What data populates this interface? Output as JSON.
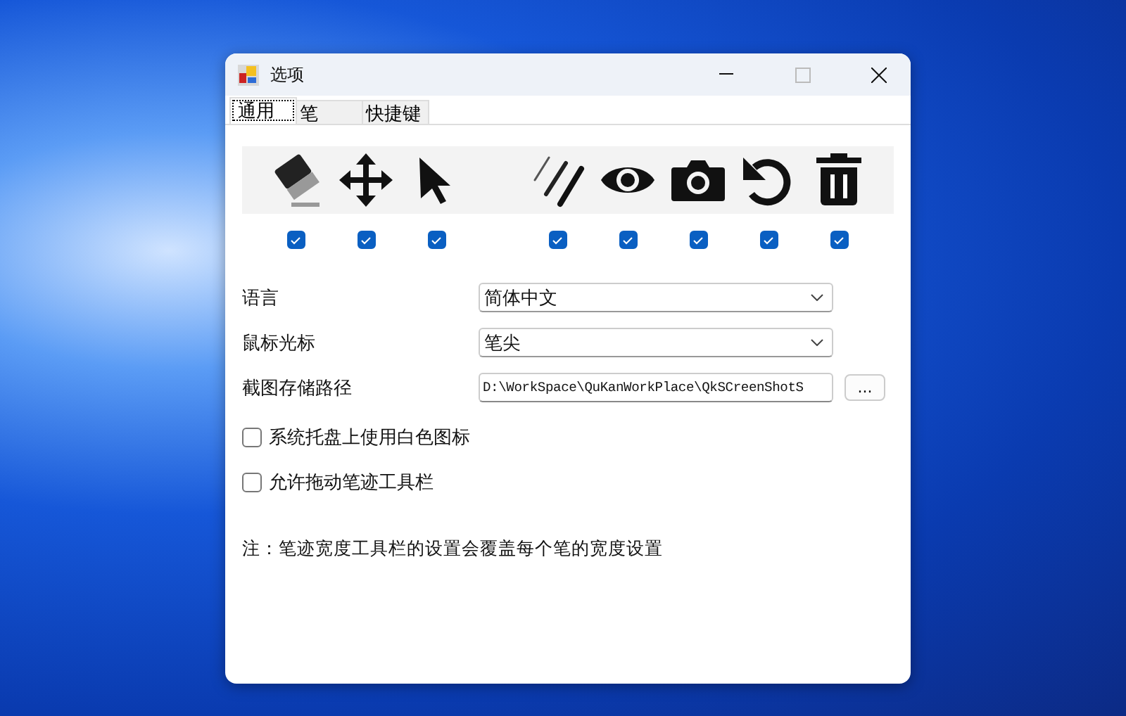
{
  "window": {
    "title": "选项"
  },
  "tabs": [
    {
      "label": "通用",
      "selected": true
    },
    {
      "label": "笔",
      "selected": false
    },
    {
      "label": "快捷键",
      "selected": false
    }
  ],
  "toolbar": {
    "groups": [
      [
        {
          "kind": "eraser",
          "checked": true
        },
        {
          "kind": "move",
          "checked": true
        },
        {
          "kind": "pointer",
          "checked": true
        }
      ],
      [
        {
          "kind": "lines",
          "checked": true
        },
        {
          "kind": "eye",
          "checked": true
        },
        {
          "kind": "camera",
          "checked": true
        },
        {
          "kind": "undo",
          "checked": true
        },
        {
          "kind": "trash",
          "checked": true
        }
      ]
    ]
  },
  "settings": [
    {
      "kind": "dropdown",
      "label": "语言",
      "value": "简体中文"
    },
    {
      "kind": "dropdown",
      "label": "鼠标光标",
      "value": "笔尖"
    },
    {
      "kind": "path",
      "label": "截图存储路径",
      "value": "D:\\WorkSpace\\QuKanWorkPlace\\QkSCreenShotS",
      "button": "..."
    }
  ],
  "options": [
    {
      "label": "系统托盘上使用白色图标",
      "checked": false
    },
    {
      "label": "允许拖动笔迹工具栏",
      "checked": false
    }
  ],
  "note": "注：笔迹宽度工具栏的设置会覆盖每个笔的宽度设置"
}
